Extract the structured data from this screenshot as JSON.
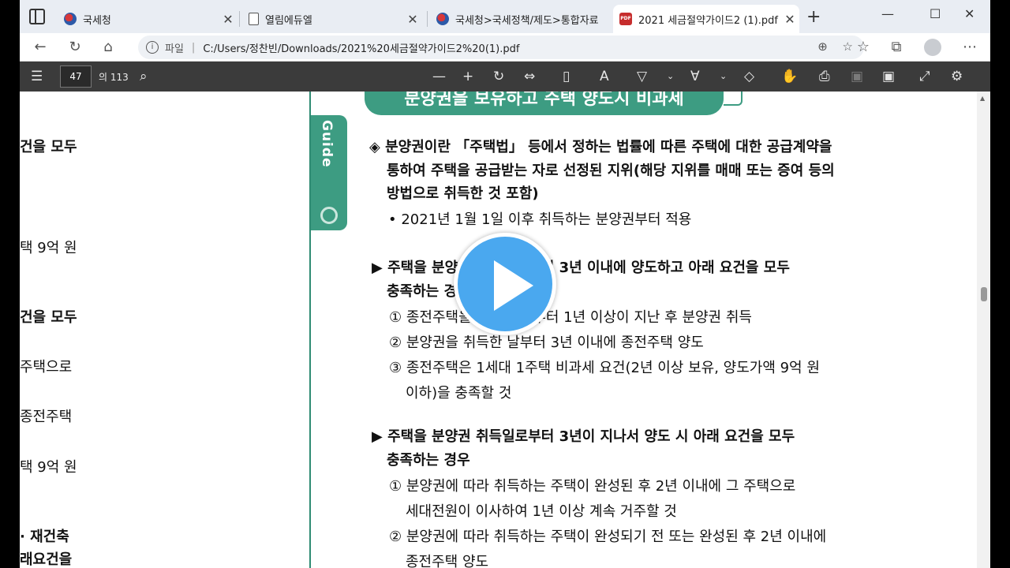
{
  "tabs": [
    {
      "title": "국세청",
      "favicon": "gov-logo-icon"
    },
    {
      "title": "열림에듀엘",
      "favicon": "document-icon"
    },
    {
      "title": "국세청>국세정책/제도>통합자료",
      "favicon": "gov-logo-icon"
    },
    {
      "title": "2021 세금절약가이드2 (1).pdf",
      "favicon": "pdf-icon"
    }
  ],
  "address": {
    "label": "파일",
    "separator": "|",
    "url": "C:/Users/정찬빈/Downloads/2021%20세금절약가이드2%20(1).pdf"
  },
  "pdf_toolbar": {
    "page_current": "47",
    "page_total": "의 113"
  },
  "left_column": [
    "건을 모두",
    "택 9억 원",
    "건을 모두",
    "주택으로",
    "종전주택",
    "택 9억 원",
    "· 재건축",
    "래요건을"
  ],
  "document": {
    "guide_tab": "Guide",
    "section_title": "분양권을 보유하고 주택 양도시 비과세",
    "definition_lines": [
      "◈ 분양권이란 「주택법」 등에서 정하는 법률에 따른 주택에 대한 공급계약을",
      "통하여 주택을 공급받는 자로 선정된 지위(해당 지위를 매매 또는 증여 등의",
      "방법으로 취득한 것 포함)"
    ],
    "bullet": "•  2021년 1월 1일 이후 취득하는 분양권부터 적용",
    "case1_lines": [
      "▶ 주택을 분양권 취득일로부터 3년 이내에 양도하고 아래 요건을 모두",
      "충족하는 경우"
    ],
    "case1_items": [
      "① 종전주택을 취득한 날부터 1년 이상이 지난 후 분양권 취득",
      "② 분양권을 취득한 날부터 3년 이내에 종전주택 양도",
      "③ 종전주택은 1세대 1주택 비과세 요건(2년 이상 보유,  양도가액 9억 원",
      "이하)을 충족할 것"
    ],
    "case2_lines": [
      "▶ 주택을 분양권 취득일로부터 3년이 지나서 양도 시 아래 요건을 모두",
      "충족하는 경우"
    ],
    "case2_items": [
      "① 분양권에 따라 취득하는 주택이 완성된 후 2년 이내에 그 주택으로",
      "세대전원이 이사하여 1년 이상 계속 거주할 것",
      "② 분양권에 따라 취득하는 주택이 완성되기 전 또는 완성된 후 2년 이내에",
      "종전주택 양도"
    ]
  },
  "colors": {
    "accent_green": "#3d9c82",
    "play_blue": "#4aa8ef",
    "toolbar_dark": "#3b3b3b"
  }
}
